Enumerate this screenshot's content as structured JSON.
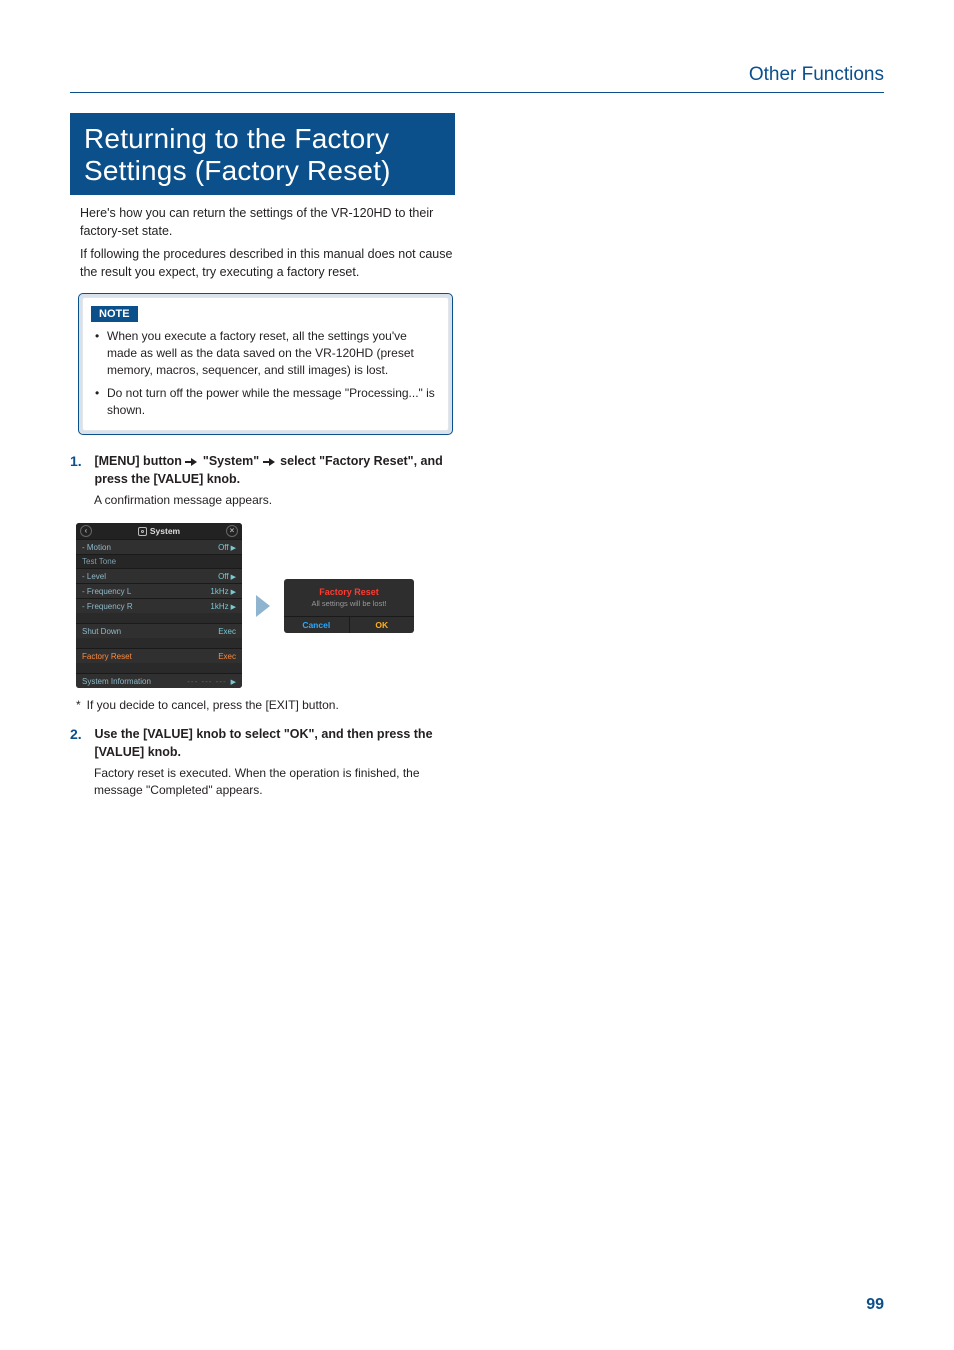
{
  "header": {
    "section": "Other Functions"
  },
  "title": "Returning to the Factory Settings (Factory Reset)",
  "intro": {
    "p1": "Here's how you can return the settings of the VR-120HD to their factory-set state.",
    "p2": "If following the procedures described in this manual does not cause the result you expect, try executing a factory reset."
  },
  "note": {
    "label": "NOTE",
    "b1": "When you execute a factory reset, all the settings you've made as well as the data saved on the VR-120HD (preset memory, macros, sequencer, and still images) is lost.",
    "b2": "Do not turn off the power while the message \"Processing...\" is shown."
  },
  "steps": {
    "s1": {
      "num": "1.",
      "t1": "[MENU] button ",
      "t2": " \"System\" ",
      "t3": " select \"Factory Reset\", and press the [VALUE] knob.",
      "body": "A confirmation message appears."
    },
    "star": "If you decide to cancel, press the [EXIT] button.",
    "s2": {
      "num": "2.",
      "head": "Use the [VALUE] knob to select \"OK\", and then press the [VALUE] knob.",
      "body": "Factory reset is executed. When the operation is finished, the message \"Completed\" appears."
    }
  },
  "sys": {
    "title": "System",
    "rows": {
      "motion": {
        "lab": "- Motion",
        "val": "Off"
      },
      "test_hdr": "Test Tone",
      "level": {
        "lab": "- Level",
        "val": "Off"
      },
      "freqL": {
        "lab": "- Frequency L",
        "val": "1kHz"
      },
      "freqR": {
        "lab": "- Frequency R",
        "val": "1kHz"
      },
      "shutdown": {
        "lab": "Shut Down",
        "val": "Exec"
      },
      "factory": {
        "lab": "Factory Reset",
        "val": "Exec"
      },
      "sysinfo": {
        "lab": "System Information"
      }
    }
  },
  "confirm": {
    "title": "Factory Reset",
    "msg": "All settings will be lost!",
    "cancel": "Cancel",
    "ok": "OK"
  },
  "page_num": "99"
}
